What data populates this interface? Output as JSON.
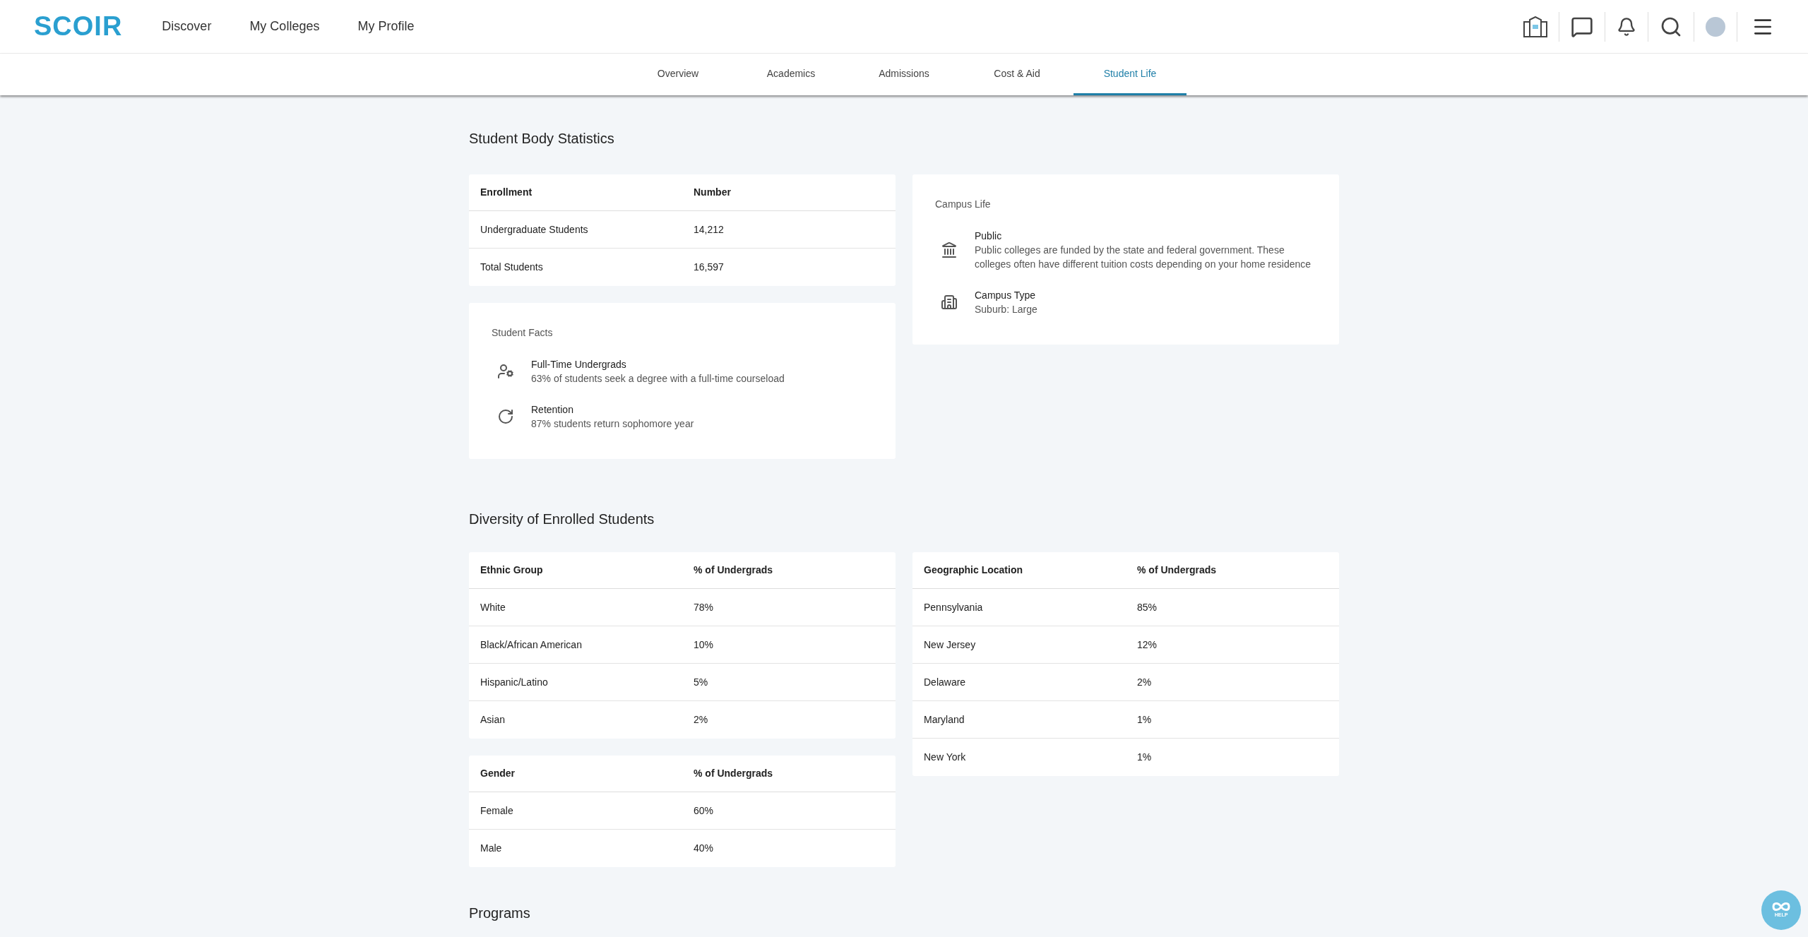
{
  "header": {
    "logo": "SCOIR",
    "nav": [
      {
        "label": "Discover",
        "selected": false
      },
      {
        "label": "My Colleges",
        "selected": false
      },
      {
        "label": "My Profile",
        "selected": false
      }
    ]
  },
  "tabs": [
    {
      "label": "Overview",
      "selected": false
    },
    {
      "label": "Academics",
      "selected": false
    },
    {
      "label": "Admissions",
      "selected": false
    },
    {
      "label": "Cost & Aid",
      "selected": false
    },
    {
      "label": "Student Life",
      "selected": true
    }
  ],
  "student_body": {
    "title": "Student Body Statistics",
    "enrollment_table": {
      "columns": [
        "Enrollment",
        "Number"
      ],
      "rows": [
        [
          "Undergraduate Students",
          "14,212"
        ],
        [
          "Total Students",
          "16,597"
        ]
      ]
    },
    "student_facts": {
      "title": "Student Facts",
      "items": [
        {
          "kind": "person",
          "title": "Full-Time Undergrads",
          "text": "63% of students seek a degree with a full-time courseload"
        },
        {
          "kind": "retention",
          "title": "Retention",
          "text": "87% students return sophomore year"
        }
      ]
    },
    "campus_life": {
      "title": "Campus Life",
      "items": [
        {
          "kind": "public",
          "title": "Public",
          "text": "Public colleges are funded by the state and federal government. These colleges often have different tuition costs depending on your home residence"
        },
        {
          "kind": "building",
          "title": "Campus Type",
          "text": "Suburb: Large"
        }
      ]
    }
  },
  "diversity": {
    "title": "Diversity of Enrolled Students",
    "ethnic_table": {
      "columns": [
        "Ethnic Group",
        "% of Undergrads"
      ],
      "rows": [
        [
          "White",
          "78%"
        ],
        [
          "Black/African American",
          "10%"
        ],
        [
          "Hispanic/Latino",
          "5%"
        ],
        [
          "Asian",
          "2%"
        ]
      ]
    },
    "gender_table": {
      "columns": [
        "Gender",
        "% of Undergrads"
      ],
      "rows": [
        [
          "Female",
          "60%"
        ],
        [
          "Male",
          "40%"
        ]
      ]
    },
    "geographic_table": {
      "columns": [
        "Geographic Location",
        "% of Undergrads"
      ],
      "rows": [
        [
          "Pennsylvania",
          "85%"
        ],
        [
          "New Jersey",
          "12%"
        ],
        [
          "Delaware",
          "2%"
        ],
        [
          "Maryland",
          "1%"
        ],
        [
          "New York",
          "1%"
        ]
      ]
    }
  },
  "programs": {
    "title": "Programs"
  },
  "help": {
    "label": "HELP"
  }
}
